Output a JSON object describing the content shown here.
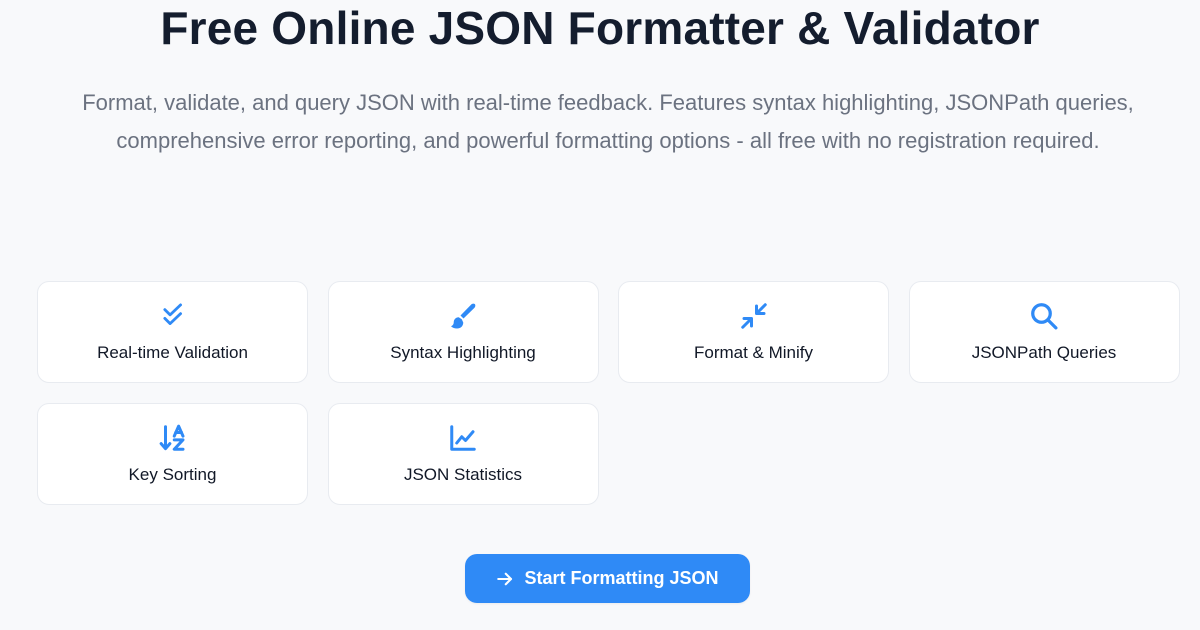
{
  "header": {
    "title": "Free Online JSON Formatter & Validator",
    "subtitle": "Format, validate, and query JSON with real-time feedback. Features syntax highlighting, JSONPath queries, comprehensive error reporting, and powerful formatting options - all free with no registration required."
  },
  "features": [
    {
      "label": "Real-time Validation",
      "icon": "double-check-icon"
    },
    {
      "label": "Syntax Highlighting",
      "icon": "paint-brush-icon"
    },
    {
      "label": "Format & Minify",
      "icon": "compress-arrows-icon"
    },
    {
      "label": "JSONPath Queries",
      "icon": "search-icon"
    },
    {
      "label": "Key Sorting",
      "icon": "sort-alpha-down-icon"
    },
    {
      "label": "JSON Statistics",
      "icon": "line-chart-icon"
    }
  ],
  "cta": {
    "label": "Start Formatting JSON",
    "icon": "arrow-right-icon"
  },
  "colors": {
    "accent": "#2f8af6",
    "background": "#f8f9fb",
    "card": "#ffffff",
    "text": "#141d2e",
    "muted": "#6b7280"
  }
}
